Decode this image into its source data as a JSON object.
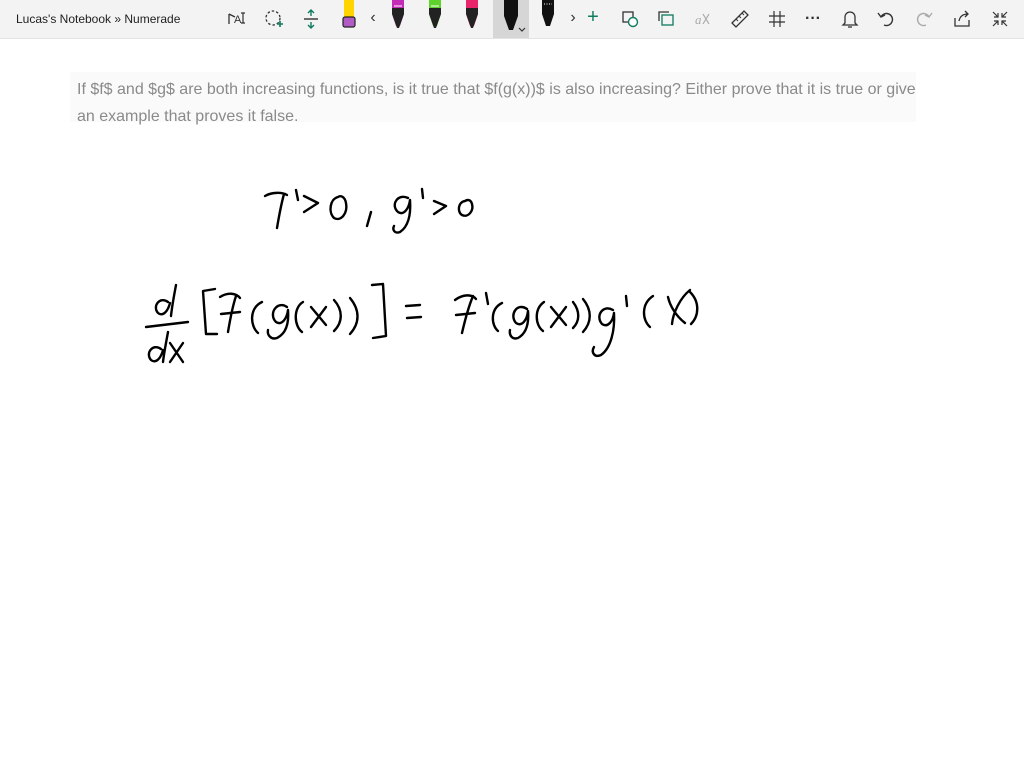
{
  "window": {
    "title": "Lucas's Notebook » Numerade"
  },
  "toolbar": {
    "icons": [
      "lasso-text-icon",
      "lasso-select-icon",
      "add-space-icon",
      "highlighter-icon",
      "pen-icon",
      "ruler-icon",
      "undo-icon",
      "redo-icon",
      "share-icon",
      "fullscreen-icon"
    ],
    "pens": [
      {
        "name": "pen-yellow-purple",
        "color": "#ffd400",
        "tip": "#b05cc4"
      },
      {
        "name": "pen-purple",
        "color": "#c42bb7"
      },
      {
        "name": "pen-green",
        "color": "#5fd22c"
      },
      {
        "name": "pen-pink",
        "color": "#e8256b"
      },
      {
        "name": "pen-black-selected",
        "color": "#111111"
      },
      {
        "name": "pen-black",
        "color": "#111111"
      }
    ],
    "more_label": "···",
    "prev_label": "‹",
    "next_label": "›",
    "add_label": "+",
    "accent_color": "#0f7b5f"
  },
  "question": {
    "text": "If $f$ and $g$ are both increasing functions, is it true that $f(g(x))$ is also increasing? Either prove that it is true or give an example that proves it false."
  },
  "handwriting": {
    "line1": "f' > 0 , g' > 0",
    "line2": "d/dx [f(g(x))] = f'(g(x)) g'(x)"
  }
}
